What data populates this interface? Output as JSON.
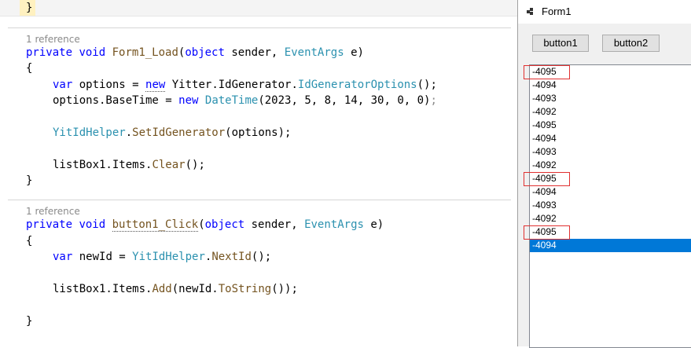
{
  "editor": {
    "top_brace": "}",
    "load_method": {
      "reference": "1 reference",
      "lines": {
        "sig_private": "private",
        "sig_void": "void",
        "sig_name": "Form1_Load",
        "sig_open": "(",
        "sig_object": "object",
        "sig_sender": " sender, ",
        "sig_eventargs": "EventArgs",
        "sig_e": " e)",
        "open": "{",
        "l1_var": "var",
        "l1_options": " options = ",
        "l1_new": "new",
        "l1_ns": " Yitter.IdGenerator.",
        "l1_type": "IdGeneratorOptions",
        "l1_end": "();",
        "l2_options": "options.BaseTime = ",
        "l2_new": "new",
        "l2_type": "DateTime",
        "l2_args": "(2023, 5, 8, 14, 30, 0, 0)",
        "l2_semi": ";",
        "l3_type": "YitIdHelper",
        "l3_dot": ".",
        "l3_method": "SetIdGenerator",
        "l3_args": "(options);",
        "l4_list": "listBox1.Items.",
        "l4_method": "Clear",
        "l4_end": "();",
        "close": "}"
      }
    },
    "click_method": {
      "reference": "1 reference",
      "lines": {
        "sig_private": "private",
        "sig_void": "void",
        "sig_name": "button1_Click",
        "sig_open": "(",
        "sig_object": "object",
        "sig_sender": " sender, ",
        "sig_eventargs": "EventArgs",
        "sig_e": " e)",
        "open": "{",
        "l1_var": "var",
        "l1_newid": " newId = ",
        "l1_type": "YitIdHelper",
        "l1_dot": ".",
        "l1_method": "NextId",
        "l1_end": "();",
        "l2_list": "listBox1.Items.",
        "l2_add": "Add",
        "l2_mid": "(newId.",
        "l2_tostring": "ToString",
        "l2_end": "());",
        "close": "}"
      }
    }
  },
  "form": {
    "title": "Form1",
    "button1_label": "button1",
    "button2_label": "button2",
    "list_items": [
      "-4095",
      "-4094",
      "-4093",
      "-4092",
      "-4095",
      "-4094",
      "-4093",
      "-4092",
      "-4095",
      "-4094",
      "-4093",
      "-4092",
      "-4095",
      "-4094"
    ],
    "selected_index": 13,
    "highlighted_indices": [
      0,
      8,
      12
    ]
  },
  "colors": {
    "keyword": "#0000ff",
    "type": "#2b91af",
    "method": "#74531f",
    "selection": "#0078d7",
    "highlight_box": "#e03030"
  }
}
